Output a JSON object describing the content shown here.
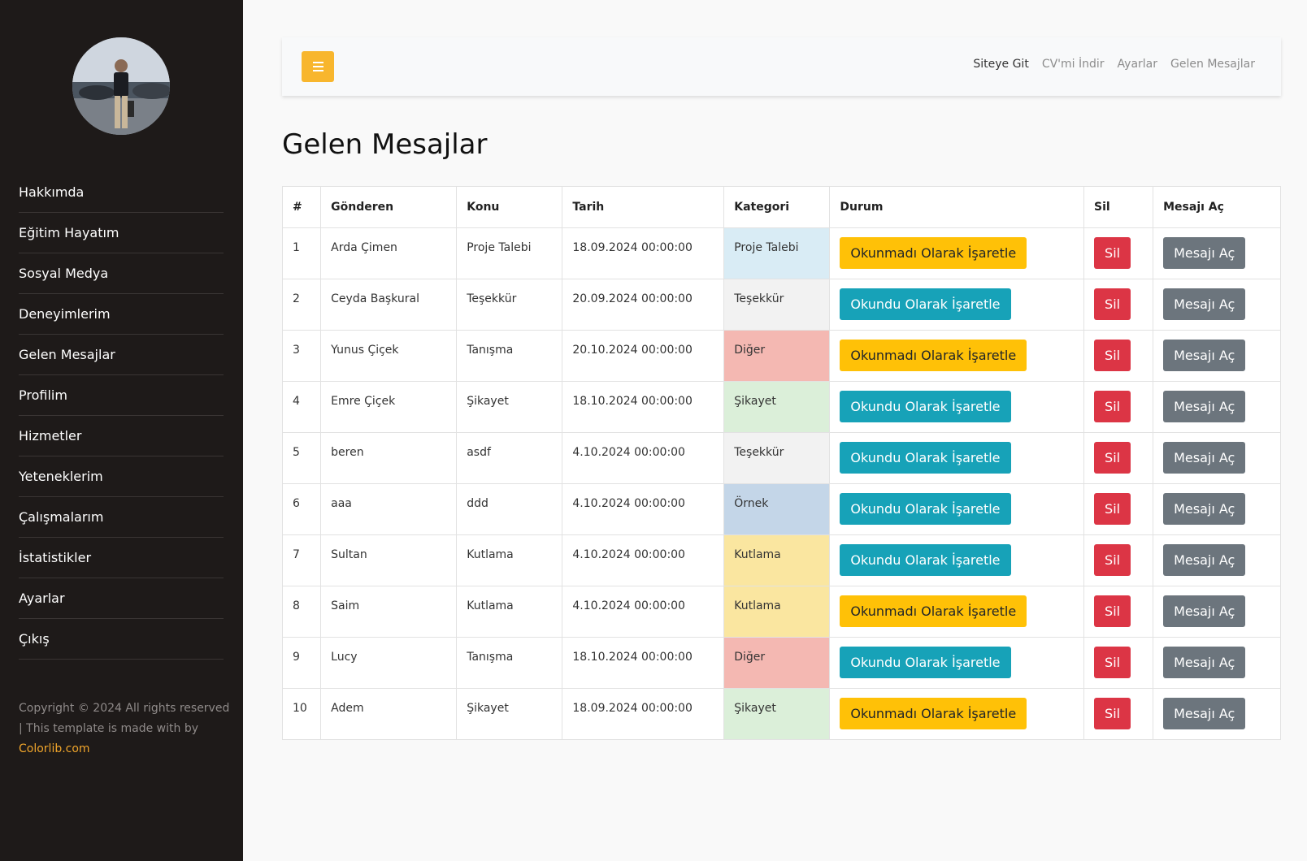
{
  "sidebar": {
    "nav": [
      "Hakkımda",
      "Eğitim Hayatım",
      "Sosyal Medya",
      "Deneyimlerim",
      "Gelen Mesajlar",
      "Profilim",
      "Hizmetler",
      "Yeteneklerim",
      "Çalışmalarım",
      "İstatistikler",
      "Ayarlar",
      "Çıkış"
    ],
    "footer_text": "Copyright © 2024 All rights reserved | This template is made with by",
    "footer_link": "Colorlib.com"
  },
  "topbar": {
    "links": [
      "Siteye Git",
      "CV'mi İndir",
      "Ayarlar",
      "Gelen Mesajlar"
    ]
  },
  "page_title": "Gelen Mesajlar",
  "table": {
    "headers": [
      "#",
      "Gönderen",
      "Konu",
      "Tarih",
      "Kategori",
      "Durum",
      "Sil",
      "Mesajı Aç"
    ],
    "labels": {
      "mark_unread": "Okunmadı Olarak İşaretle",
      "mark_read": "Okundu Olarak İşaretle",
      "delete": "Sil",
      "open": "Mesajı Aç"
    },
    "rows": [
      {
        "no": "1",
        "sender": "Arda Çimen",
        "subject": "Proje Talebi",
        "date": "18.09.2024 00:00:00",
        "category": "Proje Talebi",
        "category_color": "#d9ecf5",
        "status": "unread"
      },
      {
        "no": "2",
        "sender": "Ceyda Başkural",
        "subject": "Teşekkür",
        "date": "20.09.2024 00:00:00",
        "category": "Teşekkür",
        "category_color": "#f2f2f2",
        "status": "read"
      },
      {
        "no": "3",
        "sender": "Yunus Çiçek",
        "subject": "Tanışma",
        "date": "20.10.2024 00:00:00",
        "category": "Diğer",
        "category_color": "#f4b8b2",
        "status": "unread"
      },
      {
        "no": "4",
        "sender": "Emre Çiçek",
        "subject": "Şikayet",
        "date": "18.10.2024 00:00:00",
        "category": "Şikayet",
        "category_color": "#dbefd9",
        "status": "read"
      },
      {
        "no": "5",
        "sender": "beren",
        "subject": "asdf",
        "date": "4.10.2024 00:00:00",
        "category": "Teşekkür",
        "category_color": "#f2f2f2",
        "status": "read"
      },
      {
        "no": "6",
        "sender": "aaa",
        "subject": "ddd",
        "date": "4.10.2024 00:00:00",
        "category": "Örnek",
        "category_color": "#c4d6e8",
        "status": "read"
      },
      {
        "no": "7",
        "sender": "Sultan",
        "subject": "Kutlama",
        "date": "4.10.2024 00:00:00",
        "category": "Kutlama",
        "category_color": "#fae6a0",
        "status": "read"
      },
      {
        "no": "8",
        "sender": "Saim",
        "subject": "Kutlama",
        "date": "4.10.2024 00:00:00",
        "category": "Kutlama",
        "category_color": "#fae6a0",
        "status": "unread"
      },
      {
        "no": "9",
        "sender": "Lucy",
        "subject": "Tanışma",
        "date": "18.10.2024 00:00:00",
        "category": "Diğer",
        "category_color": "#f4b8b2",
        "status": "read"
      },
      {
        "no": "10",
        "sender": "Adem",
        "subject": "Şikayet",
        "date": "18.09.2024 00:00:00",
        "category": "Şikayet",
        "category_color": "#dbefd9",
        "status": "unread"
      }
    ]
  },
  "colors": {
    "sidebar_bg": "#1e1a19",
    "accent": "#f8b62d",
    "warning": "#ffc107",
    "info": "#17a2b8",
    "danger": "#dc3545",
    "secondary": "#6c757d"
  }
}
